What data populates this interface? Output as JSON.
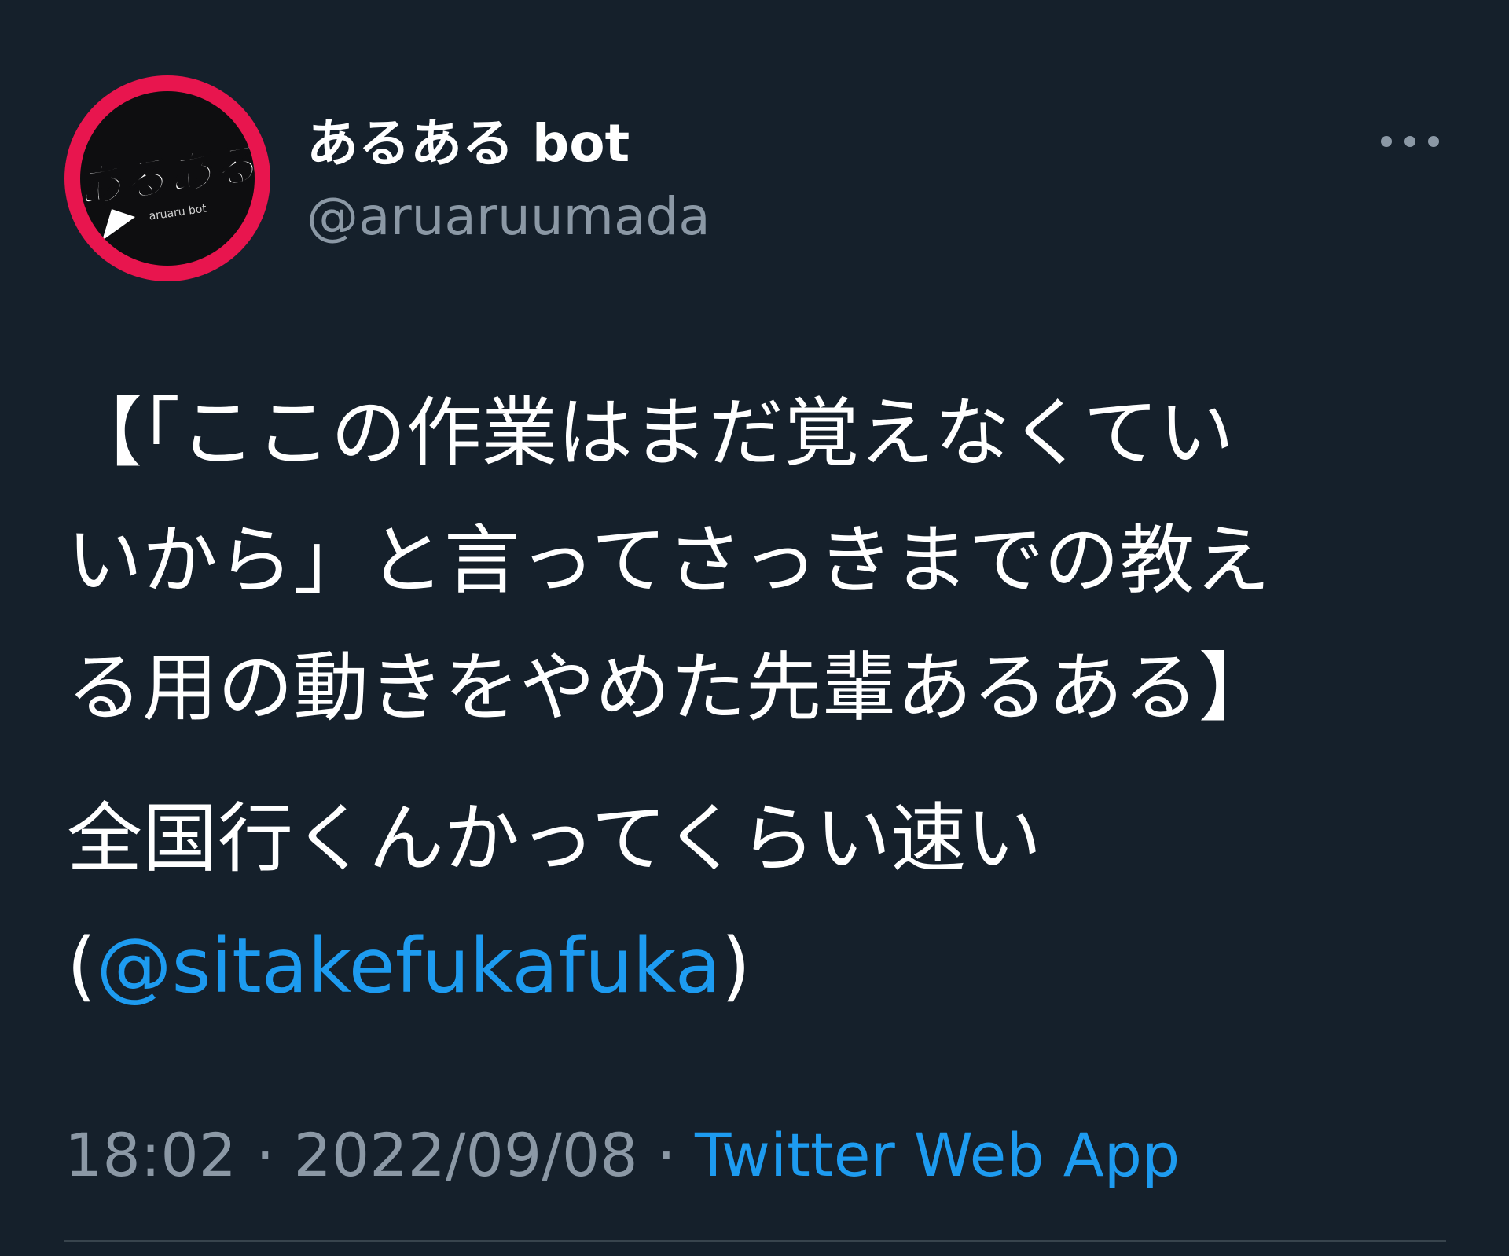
{
  "author": {
    "display_name": "あるある bot",
    "handle": "@aruaruumada",
    "avatar": {
      "logo_text": "あるある",
      "logo_subtext": "aruaru bot",
      "ring_color": "#e8154e",
      "bg_color": "#0e0e10"
    }
  },
  "more_icon": "more-horizontal-icon",
  "tweet": {
    "line1": "【「ここの作業はまだ覚えなくてい",
    "line2": "いから」と言ってさっきまでの教え",
    "line3": "る用の動きをやめた先輩あるある】",
    "line4": "全国行くんかってくらい速い",
    "paren_open": "(",
    "mention": "@sitakefukafuka",
    "paren_close": ")"
  },
  "meta": {
    "time": "18:02",
    "separator": " · ",
    "date": "2022/09/08",
    "source": "Twitter Web App"
  },
  "colors": {
    "background": "#15202b",
    "text": "#ffffff",
    "secondary": "#8b98a5",
    "link": "#1d9bf0",
    "divider": "#38444d"
  }
}
